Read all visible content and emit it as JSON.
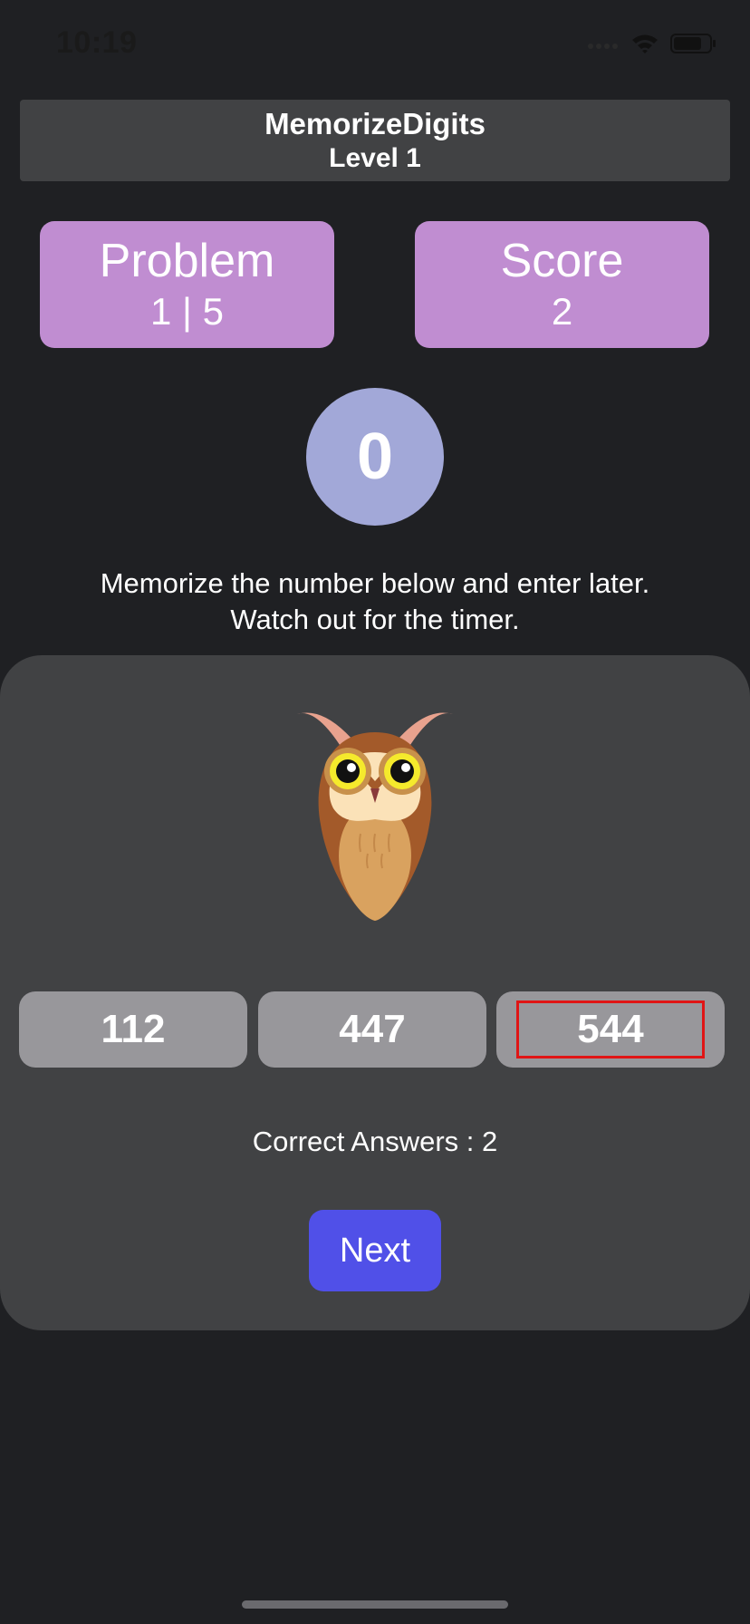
{
  "status_bar": {
    "time": "10:19"
  },
  "header": {
    "app_name": "MemorizeDigits",
    "level": "Level 1"
  },
  "stats": {
    "problem_label": "Problem",
    "problem_value": "1 | 5",
    "score_label": "Score",
    "score_value": "2"
  },
  "timer": {
    "value": "0"
  },
  "instructions": {
    "line1": "Memorize the number below and enter later.",
    "line2": "Watch out for the timer."
  },
  "choices": [
    {
      "label": "112"
    },
    {
      "label": "447"
    },
    {
      "label": "544",
      "selected": true
    }
  ],
  "result": {
    "correct_answers": "Correct Answers : 2"
  },
  "actions": {
    "next_label": "Next"
  },
  "colors": {
    "background": "#1f2023",
    "panel": "#414244",
    "stat_card": "#c08dd1",
    "timer_circle": "#a2a8d8",
    "choice": "#98979b",
    "selection_outline": "#e01515",
    "next_button": "#5050e8"
  },
  "icons": {
    "mascot": "owl-icon",
    "signal": "cellular-signal-icon",
    "wifi": "wifi-icon",
    "battery": "battery-icon"
  }
}
